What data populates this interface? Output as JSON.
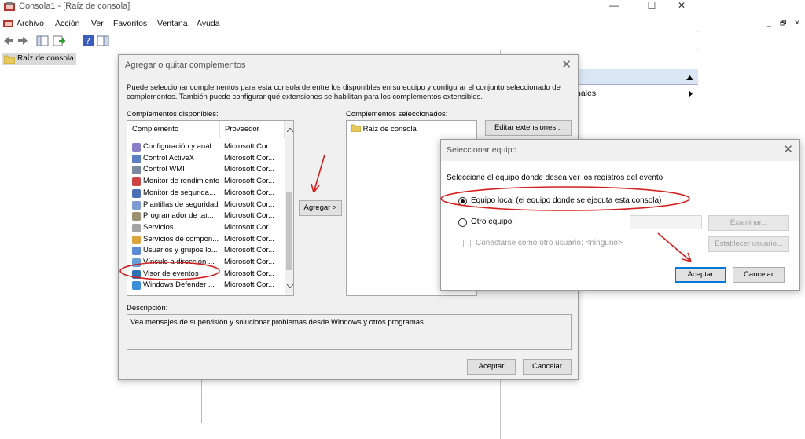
{
  "window": {
    "title": "Consola1 - [Raíz de consola]",
    "controls": [
      "—",
      "☐",
      "✕"
    ],
    "mdi_controls": [
      "_",
      "🗗",
      "✕"
    ]
  },
  "menu": [
    "Archivo",
    "Acción",
    "Ver",
    "Favoritos",
    "Ventana",
    "Ayuda"
  ],
  "tree": {
    "root": "Raíz de consola"
  },
  "actions_pane": {
    "row": "nales"
  },
  "add_remove_dialog": {
    "title": "Agregar o quitar complementos",
    "description": "Puede seleccionar complementos para esta consola de entre los disponibles en su equipo y configurar el conjunto seleccionado de complementos. También puede configurar qué extensiones se habilitan para los complementos extensibles.",
    "available_label": "Complementos disponibles:",
    "selected_label": "Complementos seleccionados:",
    "columns": [
      "Complemento",
      "Proveedor"
    ],
    "rows": [
      {
        "name": "Configuración y anál...",
        "vendor": "Microsoft Cor..."
      },
      {
        "name": "Control ActiveX",
        "vendor": "Microsoft Cor..."
      },
      {
        "name": "Control WMI",
        "vendor": "Microsoft Cor..."
      },
      {
        "name": "Monitor de rendimiento",
        "vendor": "Microsoft Cor..."
      },
      {
        "name": "Monitor de segurida...",
        "vendor": "Microsoft Cor..."
      },
      {
        "name": "Plantillas de seguridad",
        "vendor": "Microsoft Cor..."
      },
      {
        "name": "Programador de tar...",
        "vendor": "Microsoft Cor..."
      },
      {
        "name": "Servicios",
        "vendor": "Microsoft Cor..."
      },
      {
        "name": "Servicios de compon...",
        "vendor": "Microsoft Cor..."
      },
      {
        "name": "Usuarios y grupos lo...",
        "vendor": "Microsoft Cor..."
      },
      {
        "name": "Vínculo a dirección ...",
        "vendor": "Microsoft Cor..."
      },
      {
        "name": "Visor de eventos",
        "vendor": "Microsoft Cor..."
      },
      {
        "name": "Windows Defender ...",
        "vendor": "Microsoft Cor..."
      }
    ],
    "selected_root": "Raíz de consola",
    "edit_extensions": "Editar extensiones...",
    "add_button": "Agregar >",
    "desc_label": "Descripción:",
    "desc_text": "Vea mensajes de supervisión y solucionar problemas desde Windows y otros programas.",
    "ok": "Aceptar",
    "cancel": "Cancelar"
  },
  "select_computer_dialog": {
    "title": "Seleccionar equipo",
    "prompt": "Seleccione el equipo donde desea ver los registros del evento",
    "local_option": "Equipo local (el equipo donde se ejecuta esta consola)",
    "other_option": "Otro equipo:",
    "other_value": "",
    "browse": "Examinar...",
    "connect_as": "Conectarse como otro usuario: <ninguno>",
    "set_user": "Establecer usuario...",
    "ok": "Aceptar",
    "cancel": "Cancelar",
    "selected": "local"
  },
  "colors": {
    "annotation": "#d42020",
    "accent": "#0078d7",
    "selection": "#d9d9d9"
  }
}
